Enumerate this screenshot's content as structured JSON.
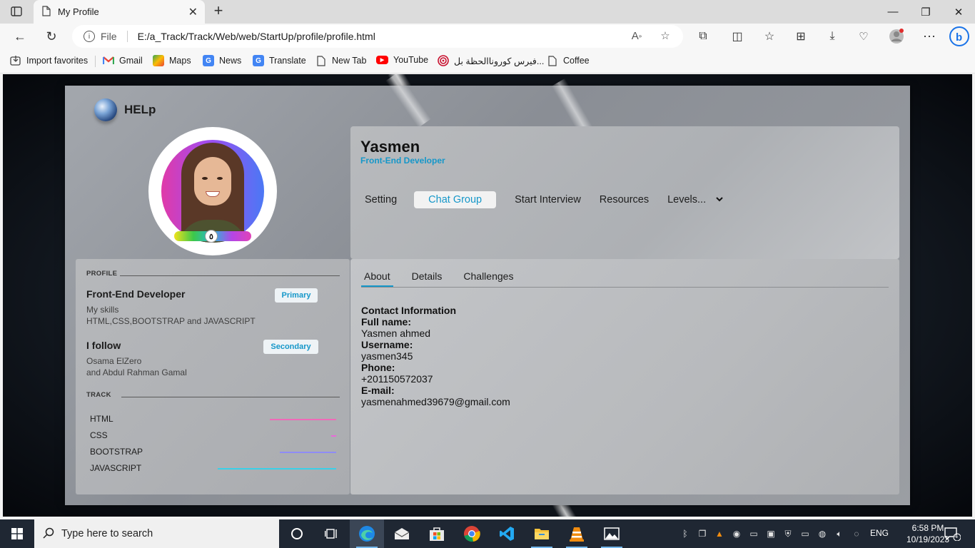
{
  "browser": {
    "tab_title": "My Profile",
    "address_scheme": "File",
    "url": "E:/a_Track/Track/Web/web/StartUp/profile/profile.html",
    "favorites": [
      {
        "label": "Import favorites",
        "icon": "import-icon"
      },
      {
        "label": "Gmail",
        "icon": "gmail-icon"
      },
      {
        "label": "Maps",
        "icon": "maps-icon"
      },
      {
        "label": "News",
        "icon": "news-icon"
      },
      {
        "label": "Translate",
        "icon": "translate-icon"
      },
      {
        "label": "New Tab",
        "icon": "page-icon"
      },
      {
        "label": "YouTube",
        "icon": "youtube-icon"
      },
      {
        "label": "فيرس كوروناالحظة بل...",
        "icon": "target-icon"
      },
      {
        "label": "Coffee",
        "icon": "page-icon"
      }
    ]
  },
  "page": {
    "brand": "HELp",
    "level_value": "٥",
    "level_fraction": 0.5,
    "profile": {
      "name": "Yasmen",
      "role": "Front-End Developer"
    },
    "nav": {
      "items": [
        "Setting",
        "Chat Group",
        "Start Interview",
        "Resources",
        "Levels..."
      ],
      "active": "Chat Group"
    },
    "side": {
      "profile_heading": "PROFILE",
      "entry1": {
        "title": "Front-End Developer",
        "badge": "Primary",
        "line1": "My skills",
        "line2": "HTML,CSS,BOOTSTRAP and JAVASCRIPT"
      },
      "entry2": {
        "title": "I follow",
        "badge": "Secondary",
        "line1": "Osama ElZero",
        "line2": "and Abdul Rahman Gamal"
      },
      "track_heading": "TRACK",
      "tracks": [
        {
          "label": "HTML",
          "level": 0.27,
          "color": "#f06ab8"
        },
        {
          "label": "CSS",
          "level": 0.02,
          "color": "#e86ad8"
        },
        {
          "label": "BOOTSTRAP",
          "level": 0.23,
          "color": "#8f8cf5"
        },
        {
          "label": "JAVASCRIPT",
          "level": 0.48,
          "color": "#3ad0e8"
        }
      ]
    },
    "tabs": {
      "items": [
        "About",
        "Details",
        "Challenges"
      ],
      "active": "About"
    },
    "contact": {
      "heading": "Contact Information",
      "fullname_label": "Full name:",
      "fullname": "Yasmen ahmed",
      "username_label": "Username:",
      "username": "yasmen345",
      "phone_label": "Phone:",
      "phone": "+201150572037",
      "email_label": "E-mail:",
      "email": "yasmenahmed39679@gmail.com"
    }
  },
  "taskbar": {
    "search_placeholder": "Type here to search",
    "lang": "ENG",
    "time": "6:58 PM",
    "date": "10/19/2023",
    "notification_count": "4"
  }
}
